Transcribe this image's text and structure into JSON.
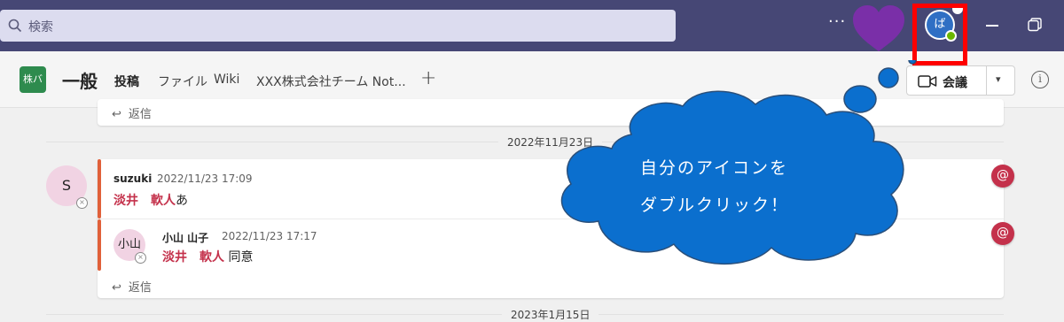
{
  "search": {
    "placeholder": "検索"
  },
  "titlebar": {
    "more": "···",
    "avatar_text": "ば"
  },
  "channel": {
    "team_avatar": "株バ",
    "name": "一般",
    "tabs": [
      {
        "label": "投稿",
        "active": true
      },
      {
        "label": "ファイル"
      },
      {
        "label": "Wiki"
      },
      {
        "label": "XXX株式会社チーム Not..."
      }
    ],
    "add_tab": "+",
    "meet_label": "会議",
    "info": "i"
  },
  "feed": {
    "prev_reply_label": "返信",
    "date1": "2022年11月23日",
    "date2": "2023年1月15日",
    "message": {
      "avatar": "S",
      "author": "suzuki",
      "time": "2022/11/23 17:09",
      "mention": "淡井　軟人",
      "text": "あ"
    },
    "reply": {
      "avatar": "小山",
      "author": "小山 山子",
      "time": "2022/11/23 17:17",
      "mention": "淡井　軟人",
      "text": " 同意"
    },
    "reply_label": "返信",
    "at_symbol": "@"
  },
  "callout": {
    "line1": "自分のアイコンを",
    "line2": "ダブルクリック！"
  },
  "colors": {
    "titlebar": "#464775",
    "mention": "#c4314b",
    "accent": "#e0603a",
    "callout": "#0b6fce",
    "highlight": "#ff0000"
  }
}
